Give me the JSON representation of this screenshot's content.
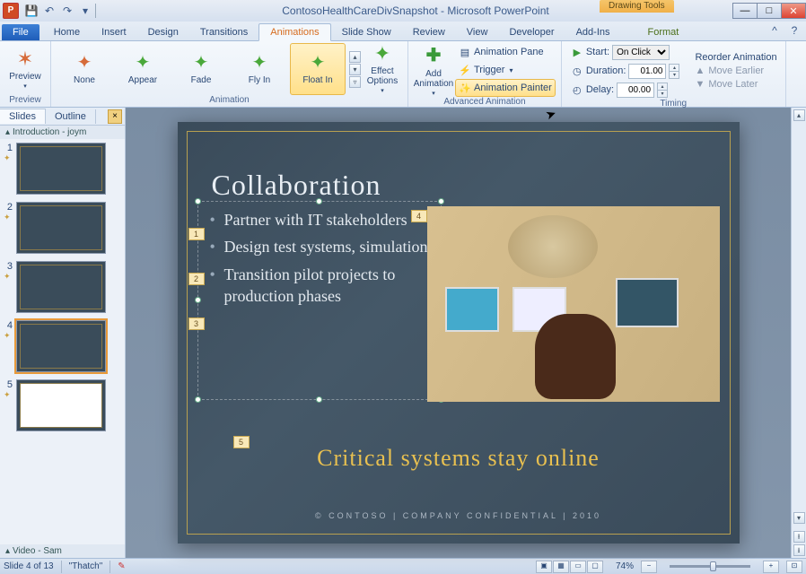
{
  "title": "ContosoHealthCareDivSnapshot - Microsoft PowerPoint",
  "tool_tab": "Drawing Tools",
  "qat": {
    "save": "💾",
    "undo": "↶",
    "redo": "↷"
  },
  "win": {
    "min": "—",
    "max": "□",
    "close": "✕",
    "help": "?"
  },
  "tabs": {
    "file": "File",
    "items": [
      "Home",
      "Insert",
      "Design",
      "Transitions",
      "Animations",
      "Slide Show",
      "Review",
      "View",
      "Developer",
      "Add-Ins"
    ],
    "context": "Format",
    "active": "Animations"
  },
  "ribbon": {
    "preview": {
      "label": "Preview",
      "group": "Preview"
    },
    "animation": {
      "group": "Animation",
      "items": [
        {
          "label": "None",
          "star": "none"
        },
        {
          "label": "Appear",
          "star": "green"
        },
        {
          "label": "Fade",
          "star": "green"
        },
        {
          "label": "Fly In",
          "star": "green"
        },
        {
          "label": "Float In",
          "star": "green"
        }
      ],
      "selected": 4,
      "effect_options": "Effect Options"
    },
    "advanced": {
      "group": "Advanced Animation",
      "add": "Add Animation",
      "pane": "Animation Pane",
      "trigger": "Trigger",
      "painter": "Animation Painter"
    },
    "timing": {
      "group": "Timing",
      "start_label": "Start:",
      "start_value": "On Click",
      "duration_label": "Duration:",
      "duration_value": "01.00",
      "delay_label": "Delay:",
      "delay_value": "00.00",
      "reorder": "Reorder Animation",
      "earlier": "Move Earlier",
      "later": "Move Later"
    }
  },
  "pane": {
    "tabs": [
      "Slides",
      "Outline"
    ],
    "sections": [
      {
        "label": "Introduction - joym"
      },
      {
        "label": "Video - Sam"
      }
    ],
    "selected": 4,
    "count": 5
  },
  "slide": {
    "title": "Collaboration",
    "bullets": [
      "Partner with IT stakeholders",
      "Design test systems, simulations",
      "Transition pilot projects to production phases"
    ],
    "tags": [
      "1",
      "2",
      "3",
      "4",
      "5"
    ],
    "subtitle": "Critical systems stay online",
    "footer": "© CONTOSO   |   COMPANY CONFIDENTIAL   |   2010"
  },
  "status": {
    "slide": "Slide 4 of 13",
    "theme": "\"Thatch\"",
    "zoom": "74%",
    "fit": "⊡"
  }
}
